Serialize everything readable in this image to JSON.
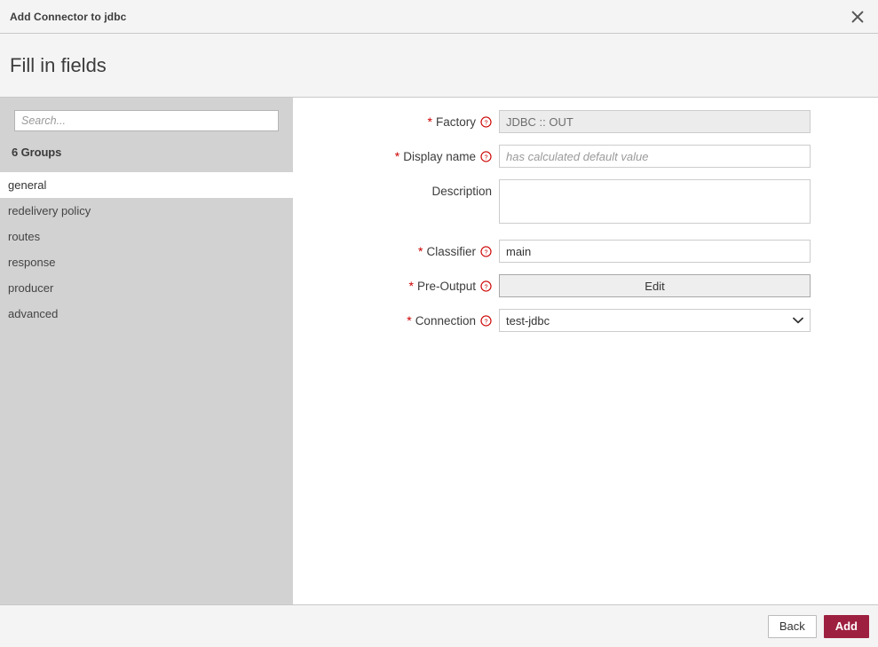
{
  "window": {
    "title": "Add Connector to jdbc",
    "close_icon": "close-icon"
  },
  "header": {
    "title": "Fill in fields"
  },
  "sidebar": {
    "search": {
      "value": "",
      "placeholder": "Search..."
    },
    "groups_count_label": "6 Groups",
    "items": [
      {
        "label": "general",
        "selected": true
      },
      {
        "label": "redelivery policy",
        "selected": false
      },
      {
        "label": "routes",
        "selected": false
      },
      {
        "label": "response",
        "selected": false
      },
      {
        "label": "producer",
        "selected": false
      },
      {
        "label": "advanced",
        "selected": false
      }
    ]
  },
  "form": {
    "help_icon": "help-circle-icon",
    "required_marker": "*",
    "fields": [
      {
        "label": "Factory",
        "required": true,
        "help": true,
        "type": "text",
        "value": "JDBC :: OUT",
        "placeholder": "",
        "disabled": true
      },
      {
        "label": "Display name",
        "required": true,
        "help": true,
        "type": "text",
        "value": "",
        "placeholder": "has calculated default value",
        "disabled": false
      },
      {
        "label": "Description",
        "required": false,
        "help": false,
        "type": "textarea",
        "value": "",
        "placeholder": "",
        "disabled": false
      },
      {
        "label": "Classifier",
        "required": true,
        "help": true,
        "type": "text",
        "value": "main",
        "placeholder": "",
        "disabled": false
      },
      {
        "label": "Pre-Output",
        "required": true,
        "help": true,
        "type": "button",
        "value": "Edit",
        "placeholder": "",
        "disabled": false
      },
      {
        "label": "Connection",
        "required": true,
        "help": true,
        "type": "select",
        "value": "test-jdbc",
        "placeholder": "",
        "disabled": false
      }
    ]
  },
  "footer": {
    "back_label": "Back",
    "add_label": "Add"
  },
  "colors": {
    "accent": "#9e2040",
    "required": "#cc0000",
    "sidebar_bg": "#d2d2d2",
    "band_bg": "#f4f4f4"
  }
}
